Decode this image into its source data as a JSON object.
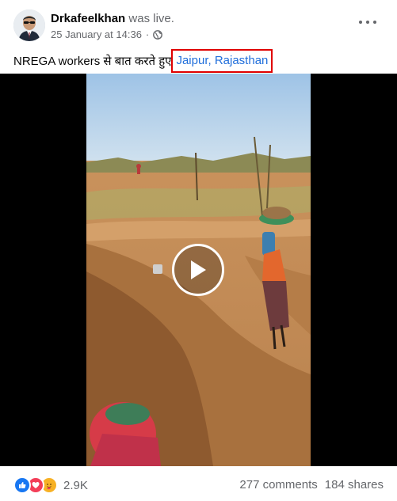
{
  "post": {
    "author": "Drkafeelkhan",
    "action": "was live.",
    "date": "25 January at 14:36",
    "separator": "·",
    "privacy_icon": "globe-icon",
    "text": "NREGA workers से बात करते हुए",
    "location": "Jaipur, Rajasthan"
  },
  "video": {
    "play_icon": "play-icon"
  },
  "footer": {
    "reaction_icons": [
      "like-icon",
      "love-icon",
      "care-icon"
    ],
    "reaction_count": "2.9K",
    "comments": "277 comments",
    "shares": "184 shares"
  },
  "colors": {
    "link": "#216fdb",
    "highlight_box": "#e00000",
    "secondary_text": "#65676b",
    "like": "#1877f2",
    "love": "#f33e58"
  }
}
